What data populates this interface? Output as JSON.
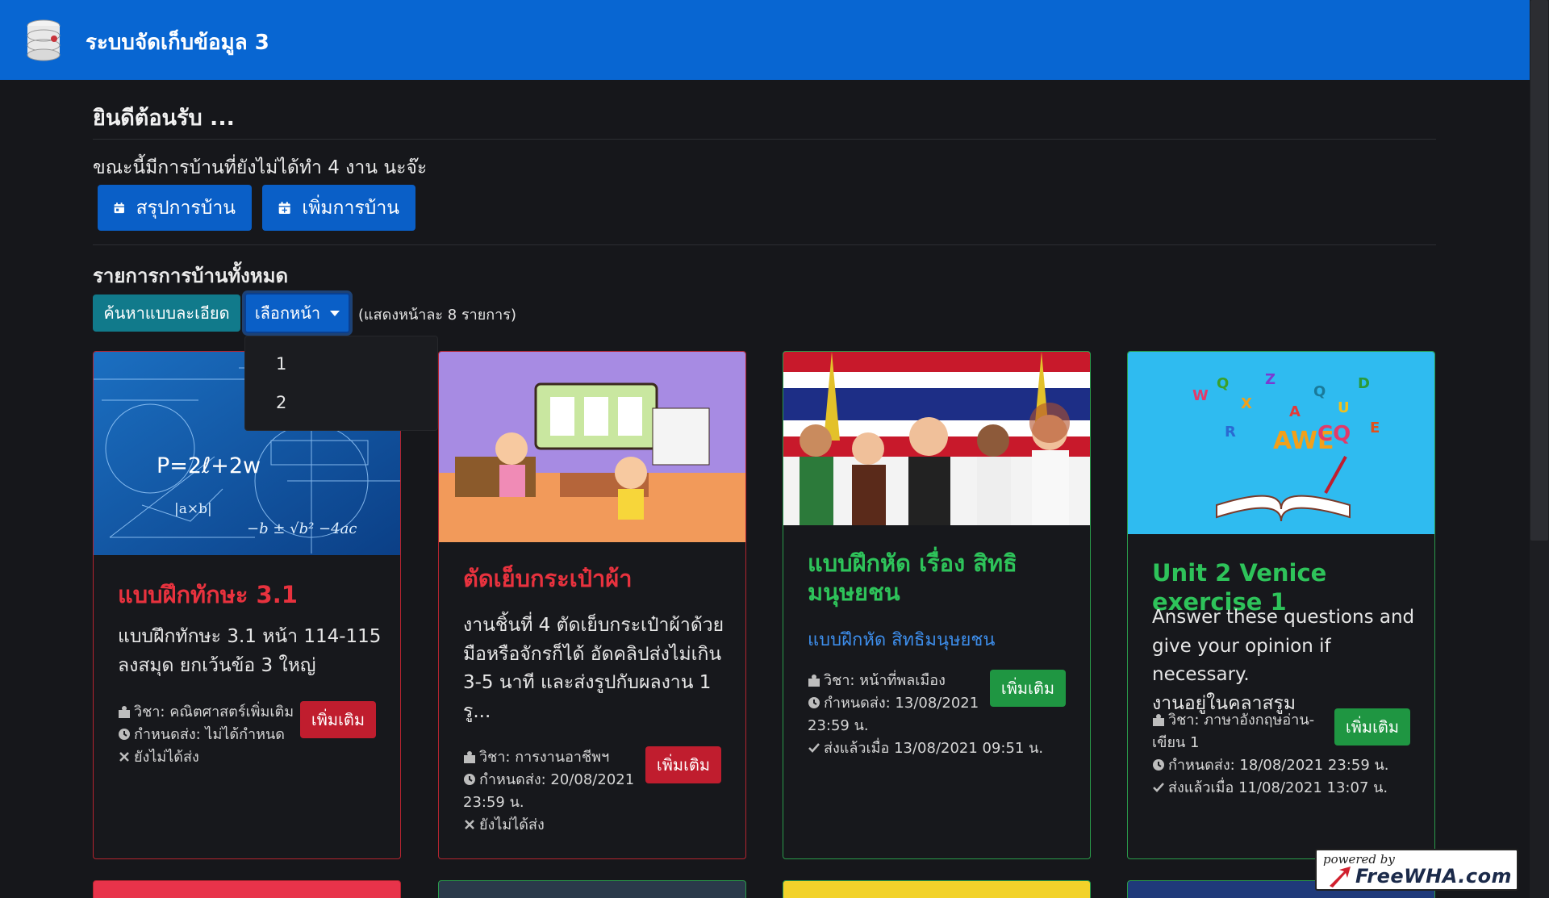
{
  "app": {
    "title": "ระบบจัดเก็บข้อมูล 3",
    "brand_color": "#0866d2"
  },
  "welcome": "ยินดีต้อนรับ ...",
  "pending_text": "ขณะนี้มีการบ้านที่ยังไม่ได้ทำ 4 งาน นะจ๊ะ",
  "actions": {
    "summary_label": "สรุปการบ้าน",
    "add_label": "เพิ่มการบ้าน"
  },
  "list": {
    "title": "รายการการบ้านทั้งหมด",
    "search_label": "ค้นหาแบบละเอียด",
    "page_select_label": "เลือกหน้า",
    "per_page": "(แสดงหน้าละ 8 รายการ)",
    "pages": [
      "1",
      "2"
    ]
  },
  "cards": [
    {
      "title": "แบบฝึกทักษะ 3.1",
      "desc_lines": [
        "แบบฝึกทักษะ 3.1 หน้า 114-115",
        "ลงสมุด ยกเว้นข้อ 3 ใหญ่"
      ],
      "subject": "วิชา: คณิตศาสตร์เพิ่มเติม",
      "deadline": "กำหนดส่ง: ไม่ได้กำหนด",
      "status": "ยังไม่ได้ส่ง",
      "more_label": "เพิ่มเติม",
      "state": "not-submitted"
    },
    {
      "title": "ตัดเย็บกระเป๋าผ้า",
      "desc_lines": [
        "งานชิ้นที่ 4 ตัดเย็บกระเป๋าผ้าด้วย",
        "มือหรือจักรก็ได้ อัดคลิปส่งไม่เกิน",
        "3-5 นาที และส่งรูปกับผลงาน 1",
        "รู..."
      ],
      "subject": "วิชา: การงานอาชีพฯ",
      "deadline_lines": [
        "กำหนดส่ง: 20/08/2021",
        "23:59 น."
      ],
      "status": "ยังไม่ได้ส่ง",
      "more_label": "เพิ่มเติม",
      "state": "not-submitted"
    },
    {
      "title_lines": [
        "แบบฝึกหัด เรื่อง สิทธิ",
        "มนุษยชน"
      ],
      "subtitle": "แบบฝึกหัด สิทธิมนุษยชน",
      "subject": "วิชา: หน้าที่พลเมือง",
      "deadline_lines": [
        "กำหนดส่ง: 13/08/2021",
        "23:59 น."
      ],
      "status": "ส่งแล้วเมื่อ 13/08/2021 09:51 น.",
      "more_label": "เพิ่มเติม",
      "state": "submitted"
    },
    {
      "title": "Unit 2 Venice exercise 1",
      "desc_lines": [
        "Answer these questions and",
        "give your opinion if necessary.",
        "งานอยู่ในคลาสรูม"
      ],
      "subject_lines": [
        "วิชา: ภาษาอังกฤษอ่าน-",
        "เขียน 1"
      ],
      "deadline": "กำหนดส่ง: 18/08/2021 23:59 น.",
      "status": "ส่งแล้วเมื่อ 11/08/2021 13:07 น.",
      "more_label": "เพิ่มเติม",
      "state": "submitted"
    }
  ],
  "card_image_text": {
    "math_formula": "P=2ℓ+2w"
  },
  "badge": {
    "small": "powered by",
    "big": "FreeWHA.com"
  }
}
